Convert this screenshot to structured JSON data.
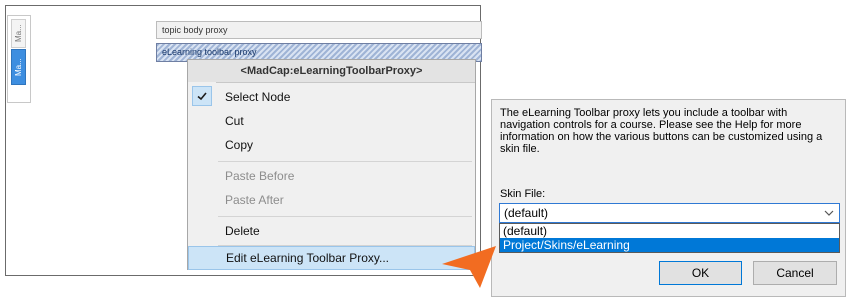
{
  "editor": {
    "side_tabs": [
      "Ma...",
      "Ma..."
    ],
    "proxy_topic_body": "topic body proxy",
    "proxy_elearning": "eLearning toolbar proxy"
  },
  "context_menu": {
    "header": "<MadCap:eLearningToolbarProxy>",
    "items": [
      {
        "label": "Select Node",
        "checked": true,
        "enabled": true
      },
      {
        "label": "Cut",
        "enabled": true
      },
      {
        "label": "Copy",
        "enabled": true
      },
      {
        "label": "Paste Before",
        "enabled": false
      },
      {
        "label": "Paste After",
        "enabled": false
      },
      {
        "label": "Delete",
        "enabled": true
      },
      {
        "label": "Edit eLearning Toolbar Proxy...",
        "enabled": true,
        "highlighted": true
      }
    ]
  },
  "dialog": {
    "description": "The eLearning Toolbar proxy lets you include a toolbar with navigation controls for a course. Please see the Help for more information on how the various buttons can be customized using a skin file.",
    "skin_label": "Skin File:",
    "skin_value": "(default)",
    "skin_options": [
      "(default)",
      "Project/Skins/eLearning"
    ],
    "selected_option": "Project/Skins/eLearning",
    "ok_label": "OK",
    "cancel_label": "Cancel"
  },
  "colors": {
    "accent": "#0078d7",
    "callout": "#f26c21",
    "menu_highlight": "#cce4f7"
  }
}
